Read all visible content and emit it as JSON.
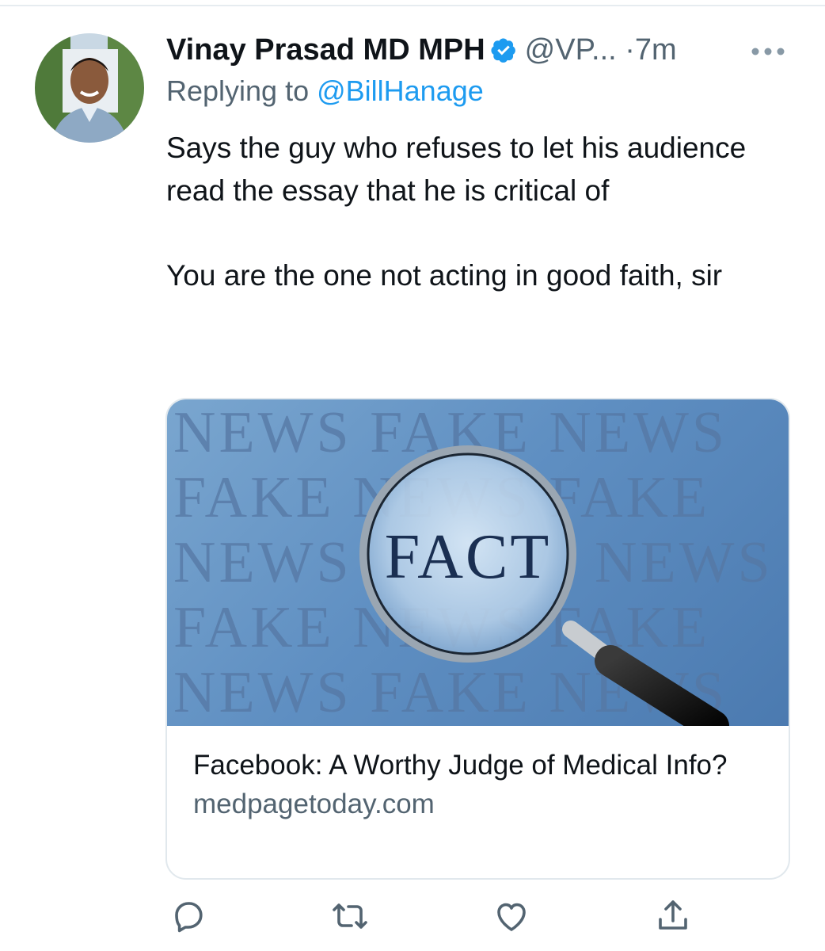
{
  "tweet": {
    "author_name": "Vinay Prasad MD MPH",
    "handle": "@VP...",
    "separator": "·",
    "timestamp": "7m",
    "replying_prefix": "Replying to ",
    "replying_to": "@BillHanage",
    "text_paragraph_1": "Says the guy who refuses to let his audience read the essay that he is critical of",
    "text_paragraph_2": "You are the one not acting in good faith, sir"
  },
  "card": {
    "title": "Facebook: A Worthy Judge of Medical Info?",
    "domain": "medpagetoday.com",
    "image_rows": [
      "NEWS FAKE NEWS",
      "FAKE NEWS FAKE",
      "NEWS FACT NEWS",
      "FAKE NEWS FAKE",
      "NEWS FAKE NEWS"
    ],
    "magnified_word": "FACT"
  },
  "icons": {
    "verified": "verified-badge-icon",
    "more": "more-icon",
    "reply": "reply-icon",
    "retweet": "retweet-icon",
    "like": "like-icon",
    "share": "share-icon"
  },
  "colors": {
    "accent": "#1d9bf0",
    "secondary_text": "#536471",
    "primary_text": "#0f1419"
  }
}
